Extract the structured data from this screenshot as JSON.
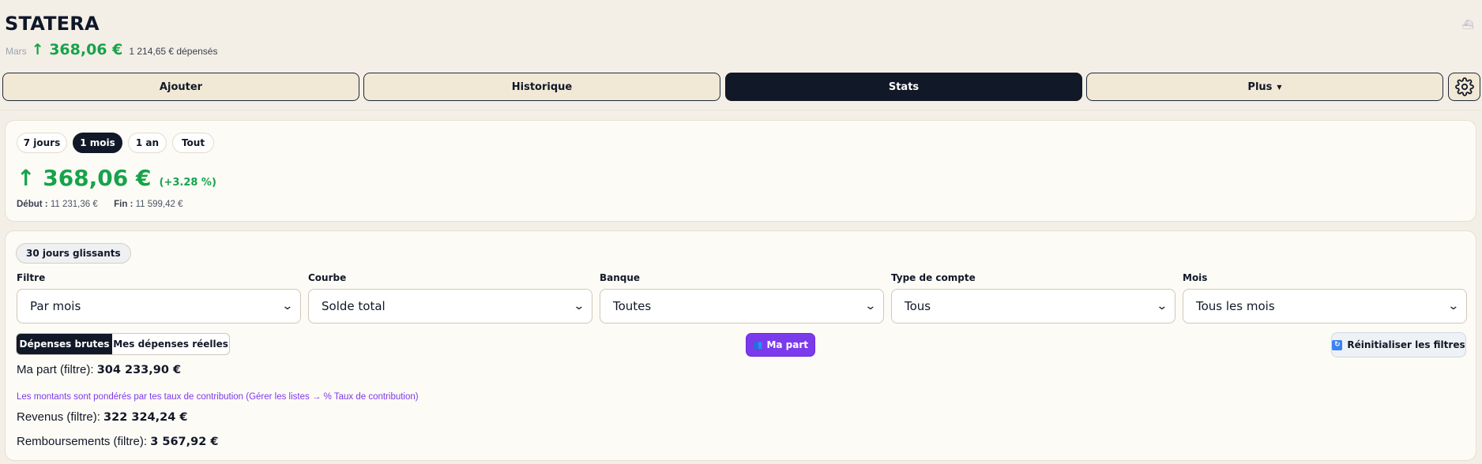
{
  "header": {
    "app_title": "STATERA",
    "month": "Mars",
    "amount": "↑ 368,06 €",
    "spent": "1 214,65 € dépensés",
    "corner_icon": "ship-icon"
  },
  "nav": {
    "items": [
      {
        "label": "Ajouter"
      },
      {
        "label": "Historique"
      },
      {
        "label": "Stats"
      },
      {
        "label": "Plus"
      }
    ],
    "active": "Stats",
    "settings_icon": "gear-icon"
  },
  "period": {
    "options": [
      "7 jours",
      "1 mois",
      "1 an",
      "Tout"
    ],
    "active": "1 mois",
    "amount": "↑ 368,06 €",
    "pct": "(+3.28 %)",
    "start_label": "Début :",
    "start_value": "11 231,36 €",
    "end_label": "Fin :",
    "end_value": "11 599,42 €"
  },
  "filters": {
    "rolling_label": "30 jours glissants",
    "fields": [
      {
        "label": "Filtre",
        "value": "Par mois"
      },
      {
        "label": "Courbe",
        "value": "Solde total"
      },
      {
        "label": "Banque",
        "value": "Toutes"
      },
      {
        "label": "Type de compte",
        "value": "Tous"
      },
      {
        "label": "Mois",
        "value": "Tous les mois"
      }
    ],
    "segment": [
      "Dépenses brutes",
      "Mes dépenses réelles"
    ],
    "segment_active": "Dépenses brutes",
    "ma_part_button": "Ma part",
    "reset_button": "Réinitialiser les filtres"
  },
  "totals": {
    "ma_part_label": "Ma part (filtre):",
    "ma_part_value": "304 233,90 €",
    "note": "Les montants sont pondérés par tes taux de contribution (Gérer les listes → % Taux de contribution)",
    "revenus_label": "Revenus (filtre):",
    "revenus_value": "322 324,24 €",
    "remb_label": "Remboursements (filtre):",
    "remb_value": "3 567,92 €"
  },
  "colors": {
    "positive": "#16a34a",
    "accent_purple": "#7c3aed",
    "dark": "#111827",
    "nav_bg": "#f1e8d6"
  }
}
